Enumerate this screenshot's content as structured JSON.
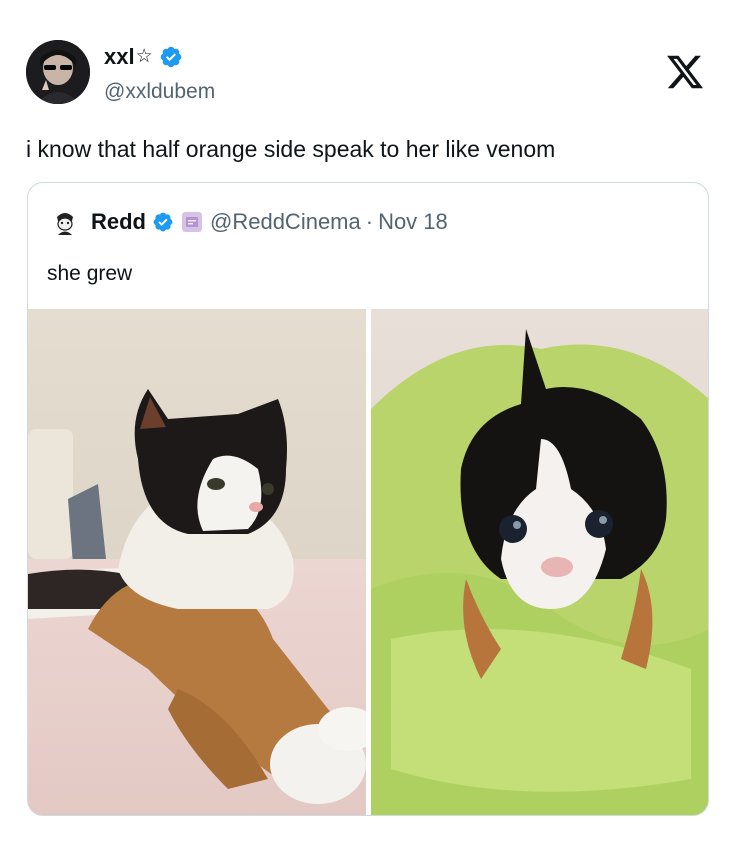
{
  "tweet": {
    "display_name": "xxl",
    "name_symbol": "☆",
    "handle": "@xxldubem",
    "text": "i know that half orange side speak to her like venom"
  },
  "quote": {
    "display_name": "Redd",
    "handle": "@ReddCinema",
    "separator": "·",
    "date": "Nov 18",
    "text": "she grew"
  },
  "icons": {
    "verified": "verified-badge-icon",
    "platform": "x-logo-icon",
    "affiliate": "affiliate-badge-icon"
  },
  "colors": {
    "verified_blue": "#1d9bf0",
    "text_primary": "#0f1419",
    "text_secondary": "#536471",
    "card_border": "#cfd9de"
  },
  "media": [
    {
      "description": "adult-calico-cat-photo"
    },
    {
      "description": "kitten-in-green-blanket-photo"
    }
  ]
}
